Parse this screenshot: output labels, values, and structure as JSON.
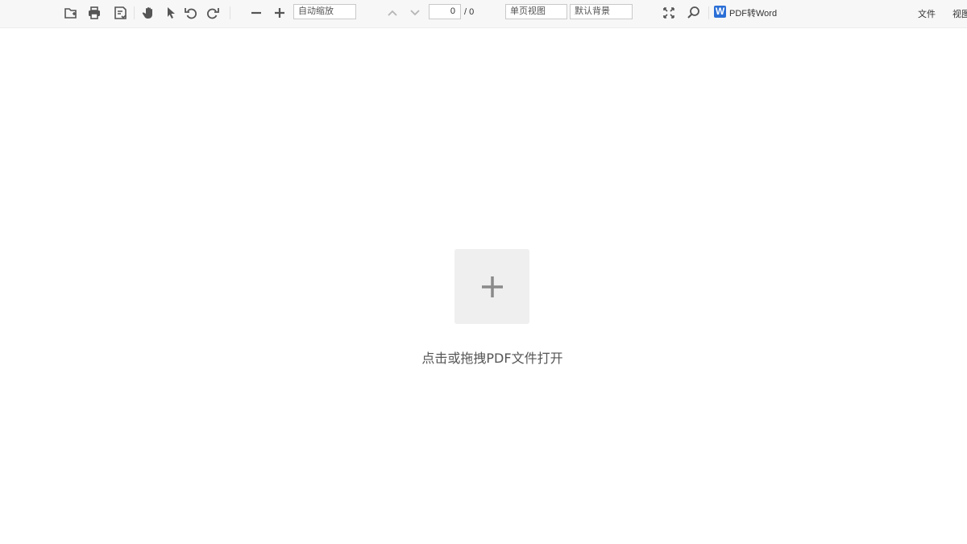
{
  "toolbar": {
    "icons": [
      "open-file-icon",
      "print-icon",
      "save-icon",
      "hand-tool-icon",
      "select-cursor-icon",
      "rotate-left-icon",
      "rotate-right-icon",
      "zoom-out-icon",
      "zoom-in-icon",
      "previous-page-icon",
      "next-page-icon",
      "fullscreen-icon",
      "search-icon",
      "word-logo-icon"
    ],
    "zoom_select": "自动缩放",
    "page_current": "0",
    "page_total": "/ 0",
    "view_mode": "单页视图",
    "background": "默认背景",
    "word_logo": "W",
    "pdf_to_word": "PDF转Word",
    "menu_file": "文件",
    "menu_view": "视图"
  },
  "main": {
    "drop_text": "点击或拖拽PDF文件打开"
  },
  "colors": {
    "toolbar_bg": "#f7f7f7",
    "icon": "#555555",
    "drop_box": "#efefef",
    "plus": "#8a8a8a",
    "word_blue": "#2b6fd6"
  }
}
